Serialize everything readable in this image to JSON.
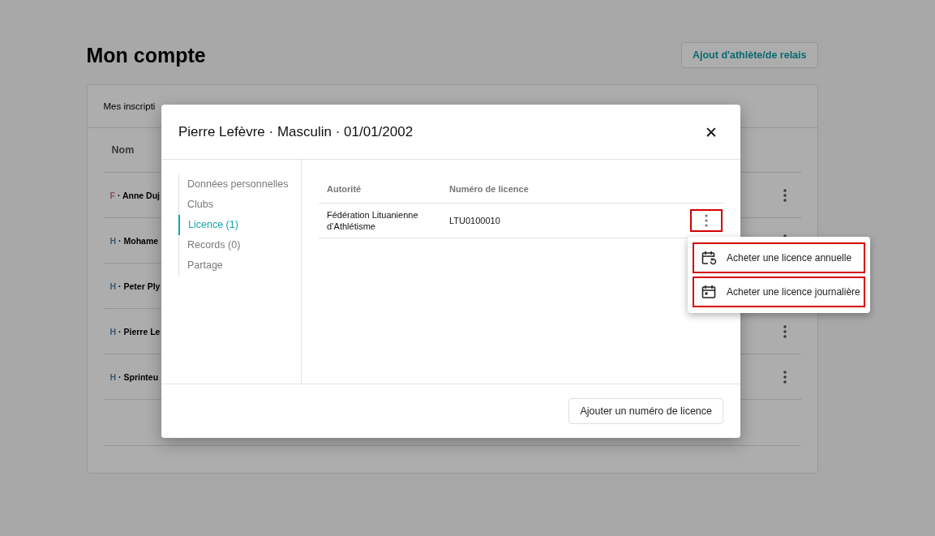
{
  "page": {
    "title": "Mon compte",
    "add_button": "Ajout d'athlète/de relais"
  },
  "card": {
    "tabs_text": "Mes inscripti",
    "columns": [
      "Nom"
    ],
    "rows": [
      {
        "sex": "F",
        "color": "#8a4c66",
        "name": "· Anne Duj"
      },
      {
        "sex": "H",
        "color": "#3c5870",
        "name": "· Mohame"
      },
      {
        "sex": "H",
        "color": "#3c5870",
        "name": "· Peter Ply"
      },
      {
        "sex": "H",
        "color": "#3c5870",
        "name": "· Pierre Le"
      },
      {
        "sex": "H",
        "color": "#3c5870",
        "name": "· Sprinteu"
      }
    ]
  },
  "modal": {
    "title": "Pierre Lefèvre · Masculin · 01/01/2002",
    "close": "✕",
    "nav": [
      {
        "label": "Données personnelles",
        "selected": false
      },
      {
        "label": "Clubs",
        "selected": false
      },
      {
        "label": "Licence (1)",
        "selected": true
      },
      {
        "label": "Records (0)",
        "selected": false
      },
      {
        "label": "Partage",
        "selected": false
      }
    ],
    "columns": [
      "Autorité",
      "Numéro de licence"
    ],
    "rows": [
      {
        "authority": "Fédération Lituanienne d’Athlétisme",
        "number": "LTU0100010",
        "highlighted": true
      }
    ],
    "menu": [
      {
        "kind": "annual",
        "label": "Acheter une licence annuelle",
        "highlighted": true
      },
      {
        "kind": "daily",
        "label": "Acheter une licence journalière",
        "highlighted": true
      }
    ],
    "footer_button": "Ajouter un numéro de licence"
  }
}
